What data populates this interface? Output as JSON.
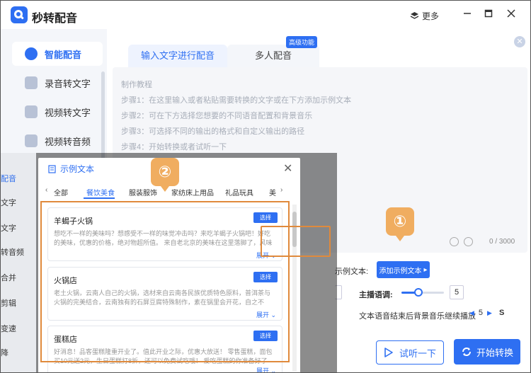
{
  "app": {
    "title": "秒转配音",
    "more_label": "更多"
  },
  "sidebar": {
    "items": [
      {
        "label": "智能配音",
        "active": true
      },
      {
        "label": "录音转文字",
        "active": false
      },
      {
        "label": "视频转文字",
        "active": false
      },
      {
        "label": "视频转音频",
        "active": false
      }
    ]
  },
  "tabs": {
    "tab1": "输入文字进行配音",
    "tab2": "多人配音",
    "badge": "高级功能"
  },
  "tutorial": {
    "heading": "制作教程",
    "steps": [
      "步骤1：在这里输入或者粘贴需要转换的文字或在下方添加示例文本",
      "步骤2：可在下方选择您想要的不同语音配置和背景音乐",
      "步骤3：可选择不同的输出的格式和自定义输出的路径",
      "步骤4：开始转换或者试听一下"
    ]
  },
  "editor": {
    "counter": "0 / 3000"
  },
  "controls": {
    "sample_label": "示例文本:",
    "add_sample": "添加示例文本",
    "tone_label": "主播语调:",
    "tone_value": "5",
    "tone_level": 0.4,
    "bg_label": "文本语音结束后背景音乐继续播放",
    "bg_value": "5",
    "bg_unit": "S",
    "try_label": "试听一下",
    "start_label": "开始转换"
  },
  "overlay_side": {
    "items": [
      "配音",
      "文字",
      "文字",
      "转音频",
      "合并",
      "剪辑",
      "变速",
      "降"
    ]
  },
  "dialog": {
    "title": "示例文本",
    "categories": [
      "全部",
      "餐饮美食",
      "服装服饰",
      "家纺床上用品",
      "礼品玩具",
      "美"
    ],
    "active_category": "餐饮美食",
    "cards": [
      {
        "title": "羊蝎子火锅",
        "pick": "选择",
        "body": "想吃不一样的美味吗？想感受不一样的味觉冲击吗？来吃羊蝎子火锅吧！好吃的美味，优惠的价格，绝对物超所值。 来自老北京的美味在这里落脚了，风味独特的",
        "expand": "展开"
      },
      {
        "title": "火锅店",
        "pick": "选择",
        "body": "老土火锅，云南人自己的火锅，选材来自云南各民族优质特色原料，普洱茶与火锅的完美结合，云南独有的石屏豆腐特殊制作，素在锅里会开花，自之不忘，神奇",
        "expand": "展开"
      },
      {
        "title": "蛋糕店",
        "pick": "选择",
        "body": "好消息！品客蛋糕隆重开业了。值此开业之际，优惠大放送！ 零售蛋糕，面包买10元送2元，生日蛋糕打8折，还可以免费试吃哦！ 爱吃蛋糕的你准备好了吗？",
        "expand": "展开"
      }
    ]
  },
  "markers": {
    "one": "①",
    "two": "②"
  },
  "colors": {
    "accent": "#2e6ff2",
    "highlight": "#e08a3c",
    "marker": "#f0ad60"
  }
}
